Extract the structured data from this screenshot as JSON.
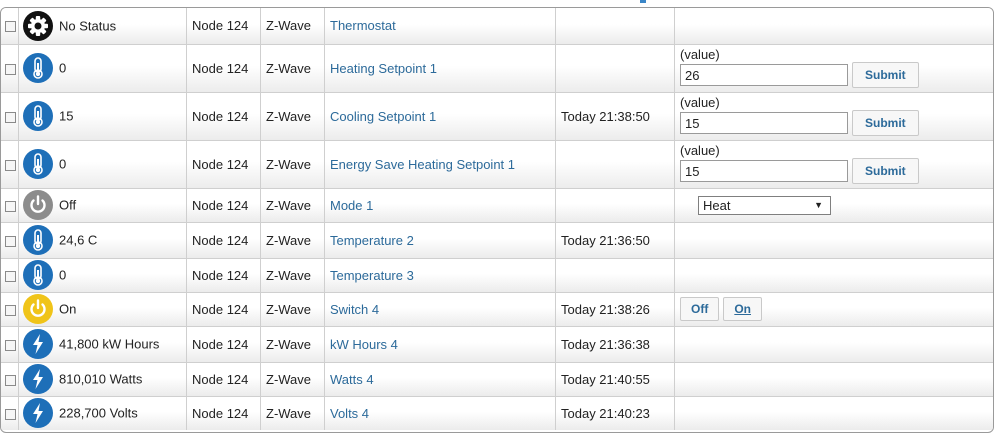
{
  "colors": {
    "icon_blue": "#1e6fb8",
    "icon_gray": "#8c8c8c",
    "icon_yellow": "#f0c419",
    "icon_black": "#111111",
    "link": "#2c6a9a"
  },
  "rows": [
    {
      "icon": "gear-icon",
      "status": "No Status",
      "node": "Node 124",
      "protocol": "Z-Wave",
      "name": "Thermostat",
      "time": ""
    },
    {
      "icon": "thermometer-icon",
      "status": "0",
      "node": "Node 124",
      "protocol": "Z-Wave",
      "name": "Heating Setpoint 1",
      "time": "",
      "control": {
        "label": "(value)",
        "value": "26",
        "button": "Submit"
      }
    },
    {
      "icon": "thermometer-icon",
      "status": "15",
      "node": "Node 124",
      "protocol": "Z-Wave",
      "name": "Cooling Setpoint 1",
      "time": "Today 21:38:50",
      "control": {
        "label": "(value)",
        "value": "15",
        "button": "Submit"
      }
    },
    {
      "icon": "thermometer-icon",
      "status": "0",
      "node": "Node 124",
      "protocol": "Z-Wave",
      "name": "Energy Save Heating Setpoint 1",
      "time": "",
      "control": {
        "label": "(value)",
        "value": "15",
        "button": "Submit"
      }
    },
    {
      "icon": "power-icon",
      "status": "Off",
      "node": "Node 124",
      "protocol": "Z-Wave",
      "name": "Mode 1",
      "time": "",
      "select": "Heat"
    },
    {
      "icon": "thermometer-icon",
      "status": "24,6 C",
      "node": "Node 124",
      "protocol": "Z-Wave",
      "name": "Temperature 2",
      "time": "Today 21:36:50"
    },
    {
      "icon": "thermometer-icon",
      "status": "0",
      "node": "Node 124",
      "protocol": "Z-Wave",
      "name": "Temperature 3",
      "time": ""
    },
    {
      "icon": "power-icon",
      "status": "On",
      "node": "Node 124",
      "protocol": "Z-Wave",
      "name": "Switch 4",
      "time": "Today 21:38:26",
      "buttons": [
        "Off",
        "On"
      ]
    },
    {
      "icon": "lightning-icon",
      "status": "41,800 kW Hours",
      "node": "Node 124",
      "protocol": "Z-Wave",
      "name": "kW Hours 4",
      "time": "Today 21:36:38"
    },
    {
      "icon": "lightning-icon",
      "status": "810,010 Watts",
      "node": "Node 124",
      "protocol": "Z-Wave",
      "name": "Watts 4",
      "time": "Today 21:40:55"
    },
    {
      "icon": "lightning-icon",
      "status": "228,700 Volts",
      "node": "Node 124",
      "protocol": "Z-Wave",
      "name": "Volts 4",
      "time": "Today 21:40:23"
    }
  ]
}
